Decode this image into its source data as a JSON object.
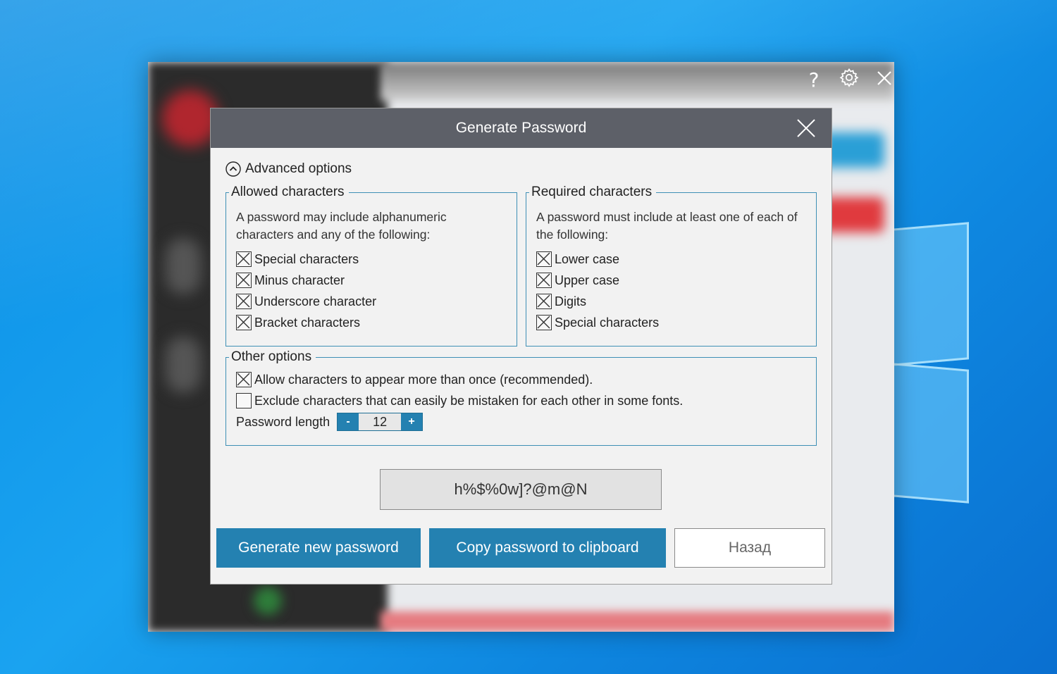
{
  "background_app": {
    "icons": [
      "help-icon",
      "gear-icon",
      "close-icon"
    ],
    "help_glyph": "?"
  },
  "dialog": {
    "title": "Generate Password",
    "advanced_options_label": "Advanced options",
    "allowed": {
      "legend": "Allowed characters",
      "description": "A password may include alphanumeric characters and any of the following:",
      "items": [
        {
          "label": "Special characters",
          "checked": true
        },
        {
          "label": "Minus character",
          "checked": true
        },
        {
          "label": "Underscore character",
          "checked": true
        },
        {
          "label": "Bracket characters",
          "checked": true
        }
      ]
    },
    "required": {
      "legend": "Required characters",
      "description": "A password must include at least one of each of the following:",
      "items": [
        {
          "label": "Lower case",
          "checked": true
        },
        {
          "label": "Upper case",
          "checked": true
        },
        {
          "label": "Digits",
          "checked": true
        },
        {
          "label": "Special characters",
          "checked": true
        }
      ]
    },
    "other": {
      "legend": "Other options",
      "items": [
        {
          "label": "Allow characters to appear more than once (recommended).",
          "checked": true
        },
        {
          "label": "Exclude characters that can easily be mistaken for each other in some fonts.",
          "checked": false
        }
      ],
      "length_label": "Password length",
      "length_minus": "-",
      "length_value": "12",
      "length_plus": "+"
    },
    "generated_password": "h%$%0w]?@m@N",
    "buttons": {
      "generate": "Generate new password",
      "copy": "Copy password to clipboard",
      "back": "Назад"
    }
  },
  "colors": {
    "accent": "#2481b1",
    "titlebar": "#5d6068",
    "group_border": "#3e8fb5",
    "desktop": "#1aa3f0"
  }
}
